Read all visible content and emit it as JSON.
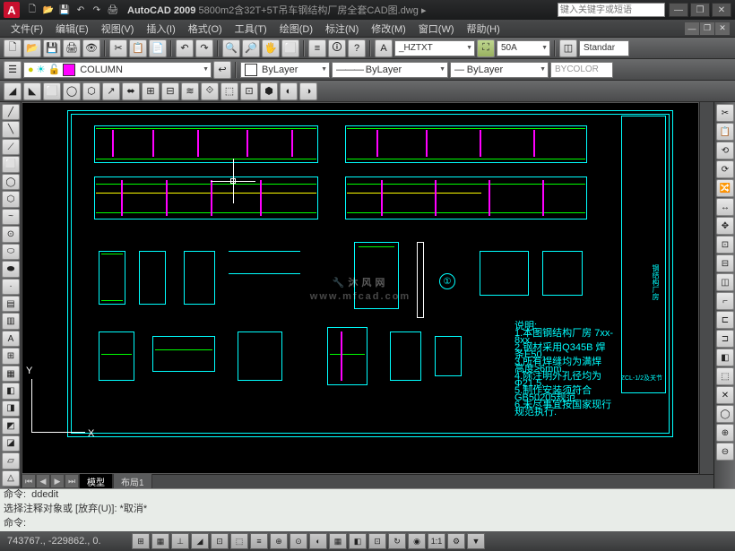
{
  "app": {
    "name": "AutoCAD 2009",
    "logo_letter": "A"
  },
  "title": {
    "filename": "5800m2含32T+5T吊车钢结构厂房全套CAD图.dwg"
  },
  "help_search_placeholder": "键入关键字或短语",
  "window_buttons": {
    "min": "—",
    "max": "❐",
    "close": "✕"
  },
  "qat": [
    "🗋",
    "📂",
    "💾",
    "↶",
    "↷",
    "🖨"
  ],
  "menu": [
    "文件(F)",
    "编辑(E)",
    "视图(V)",
    "插入(I)",
    "格式(O)",
    "工具(T)",
    "绘图(D)",
    "标注(N)",
    "修改(M)",
    "窗口(W)",
    "帮助(H)"
  ],
  "mdi": [
    "—",
    "❐",
    "✕"
  ],
  "toolbar1": {
    "buttons": [
      "🗋",
      "📂",
      "💾",
      "🖨",
      "👁",
      "✂",
      "📋",
      "📄",
      "↶",
      "↷",
      "🔍",
      "🔎",
      "🖐",
      "⬜",
      "≡",
      "🛈",
      "?"
    ],
    "style_combo": "_HZTXT",
    "annoscale": "50A",
    "standard": "Standar"
  },
  "toolbar2": {
    "layer_icons": [
      "☀",
      "❄",
      "🔒",
      "🖨"
    ],
    "layer_combo": "COLUMN",
    "color_combo": "ByLayer",
    "linetype_combo": "ByLayer",
    "lineweight_combo": "ByLayer",
    "plotstyle": "BYCOLOR"
  },
  "toolbar3_icons": [
    "◢",
    "◣",
    "⬜",
    "◯",
    "⬡",
    "↗",
    "⬌",
    "⊞",
    "⊟",
    "≋",
    "⟐",
    "⬚",
    "⊡",
    "⬢",
    "◐",
    "◑"
  ],
  "left_palette": [
    "╱",
    "╲",
    "⟋",
    "⬜",
    "◯",
    "⬡",
    "~",
    "⊙",
    "⬭",
    "⬬",
    "·",
    "▤",
    "▥",
    "A",
    "⊞",
    "▦",
    "◧",
    "◨",
    "◩",
    "◪",
    "▱",
    "△"
  ],
  "right_palette": [
    "✂",
    "📋",
    "⟲",
    "⟳",
    "🔀",
    "↔",
    "✥",
    "⊡",
    "⊟",
    "◫",
    "⌐",
    "⊏",
    "⊐",
    "◧",
    "⬚",
    "✕",
    "◯",
    "⊕",
    "⊖"
  ],
  "canvas": {
    "ucs": {
      "x": "X",
      "y": "Y"
    },
    "watermark": "沐风网",
    "watermark_url": "www.mfcad.com",
    "circle1": "①",
    "titleblock": "钢结构厂房",
    "detail_label": "ZCL-1/2及关节"
  },
  "model_tabs": {
    "nav": [
      "⏮",
      "◀",
      "▶",
      "⏭"
    ],
    "tabs": [
      "模型",
      "布局1"
    ]
  },
  "command": {
    "line1": "命令:  ddedit",
    "line2": "选择注释对象或 [放弃(U)]: *取消*",
    "prompt": "命令:"
  },
  "status": {
    "coord": "743767., -229862., 0.",
    "buttons": [
      "⊞",
      "▦",
      "⊥",
      "◢",
      "⊡",
      "⬚",
      "≡",
      "⊕",
      "⊙",
      "◐",
      "▦",
      "◧",
      "⊡",
      "↻",
      "◉",
      "1:1",
      "⚙",
      "▼"
    ]
  }
}
